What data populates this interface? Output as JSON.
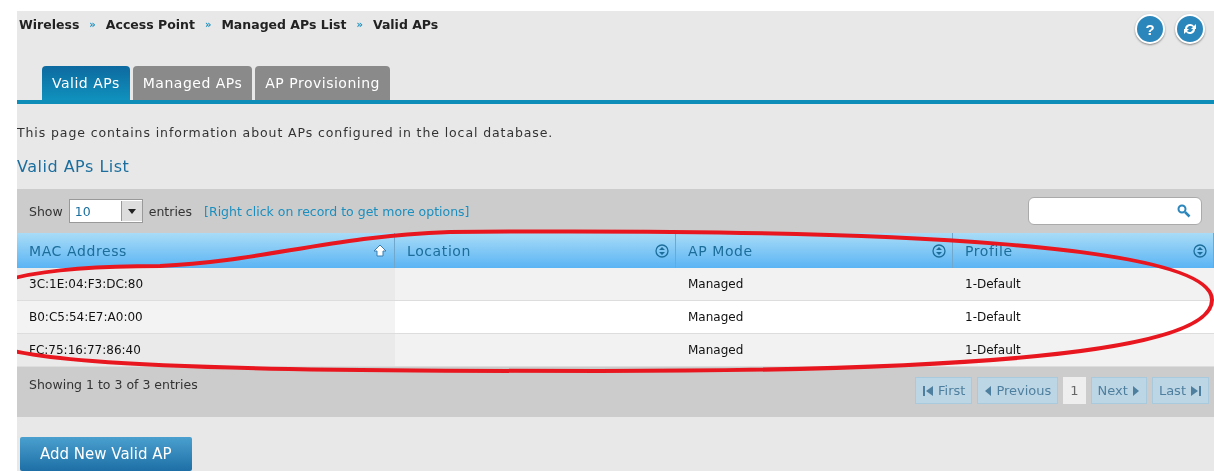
{
  "breadcrumb": [
    "Wireless",
    "Access Point",
    "Managed APs List",
    "Valid APs"
  ],
  "breadcrumb_separator": "»",
  "header_buttons": [
    {
      "kind": "help",
      "label": "?"
    },
    {
      "kind": "refresh"
    }
  ],
  "tabs": [
    {
      "label": "Valid APs",
      "selected": true
    },
    {
      "label": "Managed APs",
      "selected": false
    },
    {
      "label": "AP Provisioning",
      "selected": false
    }
  ],
  "description": "This page contains information about APs configured in the local database.",
  "section_title": "Valid APs List",
  "table_toolbar": {
    "show_label": "Show",
    "page_size": "10",
    "entries_label": "entries",
    "hint": "[Right click on record to get more options]"
  },
  "table": {
    "columns": [
      {
        "label": "MAC Address",
        "kind": "sorted_ascending"
      },
      {
        "label": "Location",
        "kind": "sortable"
      },
      {
        "label": "AP Mode",
        "kind": "sortable"
      },
      {
        "label": "Profile",
        "kind": "sortable"
      }
    ],
    "rows": [
      [
        "3C:1E:04:F3:DC:80",
        "",
        "Managed",
        "1-Default"
      ],
      [
        "B0:C5:54:E7:A0:00",
        "",
        "Managed",
        "1-Default"
      ],
      [
        "FC:75:16:77:86:40",
        "",
        "Managed",
        "1-Default"
      ]
    ]
  },
  "table_info": "Showing 1 to 3 of 3 entries",
  "pagination": [
    {
      "kind": "first",
      "label": "First",
      "disabled": true
    },
    {
      "kind": "previous",
      "label": "Previous",
      "disabled": true
    },
    {
      "kind": "page",
      "label": "1",
      "selected": true
    },
    {
      "kind": "next",
      "label": "Next",
      "disabled": true
    },
    {
      "kind": "last",
      "label": "Last",
      "disabled": true
    }
  ],
  "primary_button": "Add New Valid AP",
  "annotation": {
    "kind": "ellipse"
  }
}
